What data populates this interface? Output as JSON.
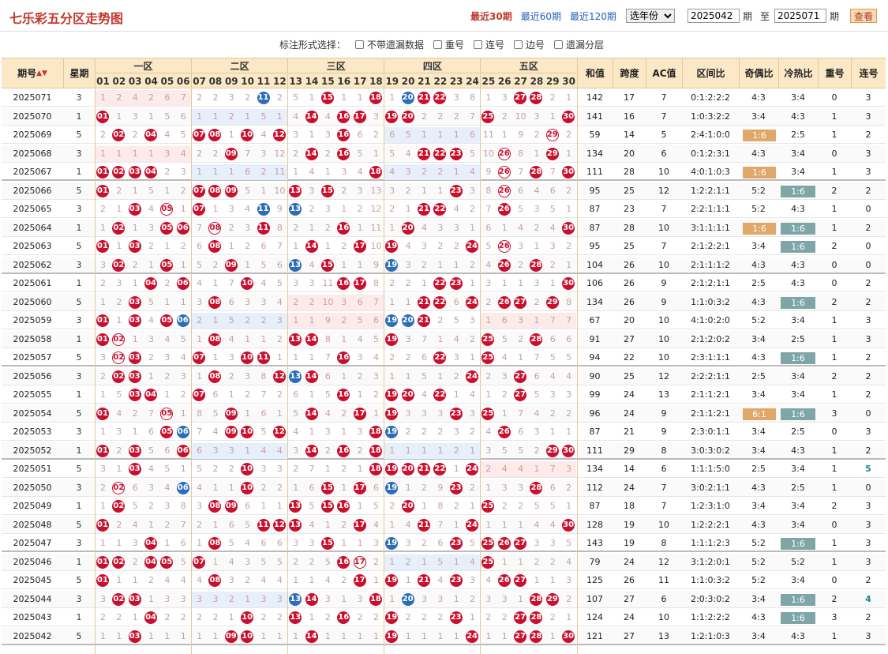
{
  "title": "七乐彩五分区走势图",
  "ranges": [
    "最近30期",
    "最近60期",
    "最近120期"
  ],
  "active_range": 0,
  "year_select": "选年份",
  "from_issue": "2025042",
  "to_issue": "2025071",
  "label_period": "期",
  "label_to": "至",
  "query_btn": "查看",
  "options_label": "标注形式选择：",
  "options": [
    "不带遗漏数据",
    "重号",
    "连号",
    "边号",
    "遗漏分层"
  ],
  "headers": {
    "issue": "期号",
    "week": "星期",
    "zones": [
      "一区",
      "二区",
      "三区",
      "四区",
      "五区"
    ],
    "sum": "和值",
    "span": "跨度",
    "ac": "AC值",
    "zone_ratio": "区间比",
    "odd_even": "奇偶比",
    "hot_cold": "冷热比",
    "repeat": "重号",
    "consecutive": "连号"
  },
  "numbers": [
    "01",
    "02",
    "03",
    "04",
    "05",
    "06",
    "07",
    "08",
    "09",
    "10",
    "11",
    "12",
    "13",
    "14",
    "15",
    "16",
    "17",
    "18",
    "19",
    "20",
    "21",
    "22",
    "23",
    "24",
    "25",
    "26",
    "27",
    "28",
    "29",
    "30"
  ],
  "rows": [
    {
      "issue": "2025071",
      "week": "3",
      "balls": [
        11,
        15,
        18,
        20,
        21,
        22,
        27,
        28
      ],
      "sum": "142",
      "span": "17",
      "ac": "7",
      "zr": "0:1:2:2:2",
      "oe": "4:3",
      "hc": "3:4",
      "rep": "0",
      "con": "3"
    },
    {
      "issue": "2025070",
      "week": "1",
      "balls": [
        1,
        14,
        16,
        17,
        19,
        20,
        25,
        30
      ],
      "sum": "141",
      "span": "16",
      "ac": "7",
      "zr": "1:0:3:2:2",
      "oe": "3:4",
      "hc": "4:3",
      "rep": "1",
      "con": "3"
    },
    {
      "issue": "2025069",
      "week": "5",
      "balls": [
        2,
        4,
        7,
        8,
        10,
        12,
        16,
        29
      ],
      "sum": "59",
      "span": "14",
      "ac": "5",
      "zr": "2:4:1:0:0",
      "oe": "1:6",
      "hc": "2:5",
      "rep": "1",
      "con": "2",
      "oe_hl": "o"
    },
    {
      "issue": "2025068",
      "week": "3",
      "balls": [
        9,
        14,
        16,
        21,
        22,
        23,
        26,
        29
      ],
      "sum": "134",
      "span": "20",
      "ac": "6",
      "zr": "0:1:2:3:1",
      "oe": "4:3",
      "hc": "3:4",
      "rep": "0",
      "con": "3"
    },
    {
      "issue": "2025067",
      "week": "1",
      "balls": [
        1,
        2,
        3,
        4,
        18,
        26,
        28,
        30
      ],
      "sum": "111",
      "span": "28",
      "ac": "10",
      "zr": "4:0:1:0:3",
      "oe": "1:6",
      "hc": "3:4",
      "rep": "1",
      "con": "3",
      "oe_hl": "o"
    },
    {
      "issue": "2025066",
      "week": "5",
      "balls": [
        1,
        7,
        8,
        9,
        13,
        15,
        23,
        26
      ],
      "sum": "95",
      "span": "25",
      "ac": "12",
      "zr": "1:2:2:1:1",
      "oe": "5:2",
      "hc": "1:6",
      "rep": "2",
      "con": "2",
      "hc_hl": "t"
    },
    {
      "issue": "2025065",
      "week": "3",
      "balls": [
        3,
        5,
        7,
        11,
        13,
        21,
        22,
        26
      ],
      "sum": "87",
      "span": "23",
      "ac": "7",
      "zr": "2:2:1:1:1",
      "oe": "5:2",
      "hc": "4:3",
      "rep": "1",
      "con": "0"
    },
    {
      "issue": "2025064",
      "week": "1",
      "balls": [
        2,
        5,
        6,
        8,
        11,
        16,
        20,
        30
      ],
      "sum": "87",
      "span": "28",
      "ac": "10",
      "zr": "3:1:1:1:1",
      "oe": "1:6",
      "hc": "1:6",
      "rep": "1",
      "con": "2",
      "oe_hl": "o",
      "hc_hl": "t"
    },
    {
      "issue": "2025063",
      "week": "5",
      "balls": [
        1,
        3,
        8,
        14,
        17,
        19,
        24,
        26
      ],
      "sum": "95",
      "span": "25",
      "ac": "7",
      "zr": "2:1:2:2:1",
      "oe": "3:4",
      "hc": "1:6",
      "rep": "2",
      "con": "0",
      "hc_hl": "t"
    },
    {
      "issue": "2025062",
      "week": "3",
      "balls": [
        2,
        5,
        9,
        13,
        15,
        19,
        26,
        28
      ],
      "sum": "104",
      "span": "26",
      "ac": "10",
      "zr": "2:1:1:1:2",
      "oe": "4:3",
      "hc": "4:3",
      "rep": "0",
      "con": "0"
    },
    {
      "issue": "2025061",
      "week": "1",
      "balls": [
        4,
        6,
        10,
        16,
        17,
        22,
        23,
        30
      ],
      "sum": "106",
      "span": "26",
      "ac": "9",
      "zr": "2:1:2:1:1",
      "oe": "2:5",
      "hc": "4:3",
      "rep": "0",
      "con": "2"
    },
    {
      "issue": "2025060",
      "week": "5",
      "balls": [
        3,
        8,
        21,
        22,
        24,
        26,
        27,
        29
      ],
      "sum": "134",
      "span": "26",
      "ac": "9",
      "zr": "1:1:0:3:2",
      "oe": "4:3",
      "hc": "1:6",
      "rep": "2",
      "con": "2",
      "hc_hl": "t"
    },
    {
      "issue": "2025059",
      "week": "3",
      "balls": [
        1,
        3,
        5,
        6,
        19,
        20,
        21
      ],
      "sum": "67",
      "span": "20",
      "ac": "10",
      "zr": "4:1:0:2:0",
      "oe": "5:2",
      "hc": "3:4",
      "rep": "1",
      "con": "3"
    },
    {
      "issue": "2025058",
      "week": "1",
      "balls": [
        1,
        2,
        8,
        13,
        14,
        19,
        25,
        28
      ],
      "sum": "91",
      "span": "27",
      "ac": "10",
      "zr": "2:1:2:0:2",
      "oe": "3:4",
      "hc": "2:5",
      "rep": "1",
      "con": "3"
    },
    {
      "issue": "2025057",
      "week": "5",
      "balls": [
        2,
        3,
        7,
        10,
        11,
        16,
        22,
        25
      ],
      "sum": "94",
      "span": "22",
      "ac": "10",
      "zr": "2:3:1:1:1",
      "oe": "4:3",
      "hc": "1:6",
      "rep": "1",
      "con": "2",
      "hc_hl": "t"
    },
    {
      "issue": "2025056",
      "week": "3",
      "balls": [
        2,
        3,
        8,
        12,
        13,
        14,
        24,
        27
      ],
      "sum": "90",
      "span": "25",
      "ac": "12",
      "zr": "2:2:2:1:1",
      "oe": "2:5",
      "hc": "3:4",
      "rep": "2",
      "con": "2"
    },
    {
      "issue": "2025055",
      "week": "1",
      "balls": [
        3,
        4,
        7,
        16,
        19,
        20,
        22,
        27
      ],
      "sum": "99",
      "span": "24",
      "ac": "13",
      "zr": "2:1:1:2:1",
      "oe": "3:4",
      "hc": "3:4",
      "rep": "1",
      "con": "2"
    },
    {
      "issue": "2025054",
      "week": "5",
      "balls": [
        1,
        5,
        9,
        14,
        17,
        19,
        23,
        25
      ],
      "sum": "96",
      "span": "24",
      "ac": "9",
      "zr": "2:1:1:2:1",
      "oe": "6:1",
      "hc": "1:6",
      "rep": "3",
      "con": "0",
      "oe_hl": "o",
      "hc_hl": "t"
    },
    {
      "issue": "2025053",
      "week": "3",
      "balls": [
        5,
        6,
        9,
        10,
        12,
        18,
        19,
        26
      ],
      "sum": "87",
      "span": "21",
      "ac": "9",
      "zr": "2:3:0:1:1",
      "oe": "3:4",
      "hc": "2:5",
      "rep": "0",
      "con": "3"
    },
    {
      "issue": "2025052",
      "week": "1",
      "balls": [
        1,
        3,
        6,
        14,
        16,
        18,
        29,
        30
      ],
      "sum": "111",
      "span": "29",
      "ac": "8",
      "zr": "3:0:3:0:2",
      "oe": "3:4",
      "hc": "4:3",
      "rep": "1",
      "con": "2"
    },
    {
      "issue": "2025051",
      "week": "5",
      "balls": [
        3,
        10,
        18,
        19,
        20,
        21,
        22,
        24
      ],
      "sum": "134",
      "span": "14",
      "ac": "6",
      "zr": "1:1:1:5:0",
      "oe": "2:5",
      "hc": "3:4",
      "rep": "1",
      "con": "5",
      "con_c": "teal"
    },
    {
      "issue": "2025050",
      "week": "3",
      "balls": [
        2,
        6,
        10,
        15,
        17,
        19,
        23,
        28
      ],
      "sum": "112",
      "span": "24",
      "ac": "7",
      "zr": "3:0:2:1:1",
      "oe": "4:3",
      "hc": "2:5",
      "rep": "1",
      "con": "0"
    },
    {
      "issue": "2025049",
      "week": "1",
      "balls": [
        2,
        8,
        9,
        13,
        15,
        16,
        20,
        25
      ],
      "sum": "87",
      "span": "18",
      "ac": "7",
      "zr": "1:2:3:1:0",
      "oe": "3:4",
      "hc": "3:4",
      "rep": "2",
      "con": "3"
    },
    {
      "issue": "2025048",
      "week": "5",
      "balls": [
        1,
        11,
        12,
        13,
        17,
        21,
        24,
        30
      ],
      "sum": "128",
      "span": "19",
      "ac": "10",
      "zr": "1:2:2:2:1",
      "oe": "4:3",
      "hc": "3:4",
      "rep": "0",
      "con": "3"
    },
    {
      "issue": "2025047",
      "week": "3",
      "balls": [
        4,
        8,
        15,
        19,
        23,
        25,
        26,
        27
      ],
      "sum": "143",
      "span": "19",
      "ac": "8",
      "zr": "1:1:1:2:3",
      "oe": "5:2",
      "hc": "1:6",
      "rep": "1",
      "con": "3",
      "hc_hl": "t"
    },
    {
      "issue": "2025046",
      "week": "1",
      "balls": [
        1,
        2,
        4,
        5,
        7,
        16,
        17,
        25
      ],
      "sum": "79",
      "span": "24",
      "ac": "12",
      "zr": "3:1:2:0:1",
      "oe": "5:2",
      "hc": "5:2",
      "rep": "1",
      "con": "3"
    },
    {
      "issue": "2025045",
      "week": "5",
      "balls": [
        1,
        8,
        17,
        19,
        21,
        23,
        26,
        27
      ],
      "sum": "125",
      "span": "26",
      "ac": "11",
      "zr": "1:1:0:3:2",
      "oe": "5:2",
      "hc": "3:4",
      "rep": "0",
      "con": "2"
    },
    {
      "issue": "2025044",
      "week": "3",
      "balls": [
        2,
        3,
        13,
        14,
        18,
        20,
        28,
        29
      ],
      "sum": "107",
      "span": "27",
      "ac": "6",
      "zr": "2:0:3:0:2",
      "oe": "3:4",
      "hc": "1:6",
      "rep": "2",
      "con": "4",
      "hc_hl": "t",
      "con_c": "teal"
    },
    {
      "issue": "2025043",
      "week": "1",
      "balls": [
        4,
        10,
        13,
        16,
        19,
        23,
        27,
        28
      ],
      "sum": "124",
      "span": "24",
      "ac": "10",
      "zr": "1:1:2:2:2",
      "oe": "4:3",
      "hc": "1:6",
      "rep": "3",
      "con": "2",
      "hc_hl": "t"
    },
    {
      "issue": "2025042",
      "week": "5",
      "balls": [
        3,
        9,
        10,
        14,
        19,
        24,
        27,
        28,
        30
      ],
      "sum": "121",
      "span": "27",
      "ac": "13",
      "zr": "1:2:1:0:3",
      "oe": "3:4",
      "hc": "4:3",
      "rep": "1",
      "con": "3"
    }
  ]
}
